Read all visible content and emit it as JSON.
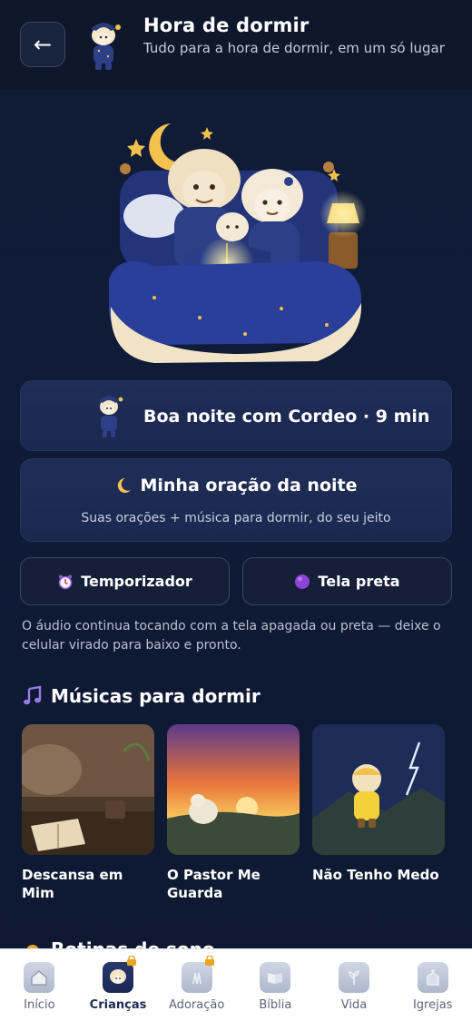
{
  "header": {
    "back_label": "←",
    "title": "Hora de dormir",
    "subtitle": "Tudo para a hora de dormir, em um só lugar"
  },
  "actions": {
    "cordeo_label": "Boa noite com Cordeo · 9 min",
    "oracao_label": "Minha oração da noite",
    "oracao_sub": "Suas orações + música para dormir, do seu jeito",
    "timer_label": "Temporizador",
    "black_label": "Tela preta"
  },
  "note": "O áudio continua tocando com a tela apagada ou preta — deixe o celular virado para baixo e pronto.",
  "music_section": {
    "title": "Músicas para dormir",
    "items": [
      {
        "title": "Descansa em Mim"
      },
      {
        "title": "O Pastor Me Guarda"
      },
      {
        "title": "Não Tenho Medo"
      }
    ]
  },
  "next_section": {
    "title": "Rotinas de sono"
  },
  "nav": {
    "items": [
      {
        "label": "Início"
      },
      {
        "label": "Crianças"
      },
      {
        "label": "Adoração"
      },
      {
        "label": "Bíblia"
      },
      {
        "label": "Vida"
      },
      {
        "label": "Igrejas"
      }
    ],
    "active": "Crianças"
  },
  "colors": {
    "background": "#0f1a33",
    "card": "#1f2d58",
    "accent_gold": "#f2c14e",
    "nav_bg": "#ffffff"
  }
}
